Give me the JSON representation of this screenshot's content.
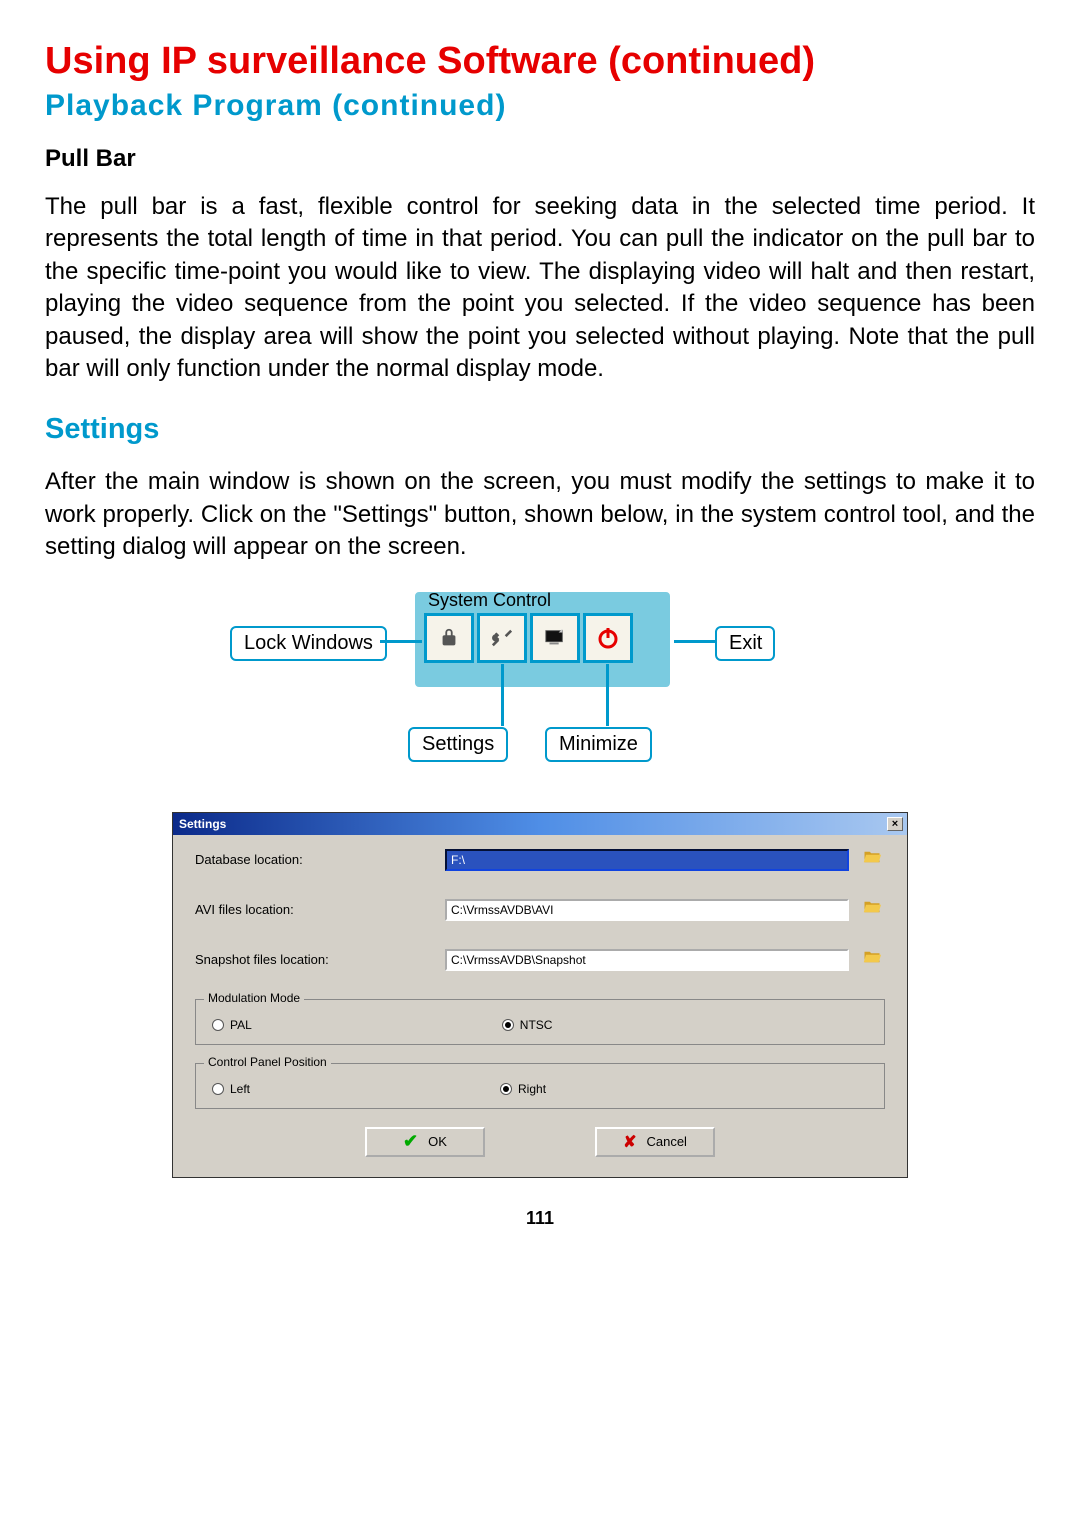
{
  "headings": {
    "main_title": "Using IP surveillance Software (continued)",
    "sub_title": "Playback  Program  (continued)",
    "pull_bar": "Pull Bar",
    "settings": "Settings"
  },
  "paragraphs": {
    "pull_bar_text": "The pull bar is a fast, flexible control for seeking data in the selected time period. It represents the total length of time in that period. You can pull the indicator on the pull bar to the specific time-point you would like to view. The displaying video will halt and then restart, playing the video sequence from the point you selected. If the video sequence has been paused, the display area will show the point you selected without playing. Note that the pull bar will only function under the normal display mode.",
    "settings_text": "After the main window is shown on the screen, you must modify the settings to make it to work properly. Click on the \"Settings\" button, shown below, in the system control tool, and the setting dialog will appear on the screen."
  },
  "diagram": {
    "legend": "System Control",
    "lock_windows": "Lock Windows",
    "exit": "Exit",
    "settings": "Settings",
    "minimize": "Minimize"
  },
  "dialog": {
    "title": "Settings",
    "close": "×",
    "labels": {
      "db_location": "Database location:",
      "avi_location": "AVI files location:",
      "snapshot_location": "Snapshot files location:"
    },
    "values": {
      "db": "F:\\",
      "avi": "C:\\VrmssAVDB\\AVI",
      "snapshot": "C:\\VrmssAVDB\\Snapshot"
    },
    "groups": {
      "modulation": "Modulation Mode",
      "panel_pos": "Control Panel Position"
    },
    "radios": {
      "pal": "PAL",
      "ntsc": "NTSC",
      "left": "Left",
      "right": "Right"
    },
    "buttons": {
      "ok": "OK",
      "cancel": "Cancel"
    }
  },
  "page_number": "111"
}
